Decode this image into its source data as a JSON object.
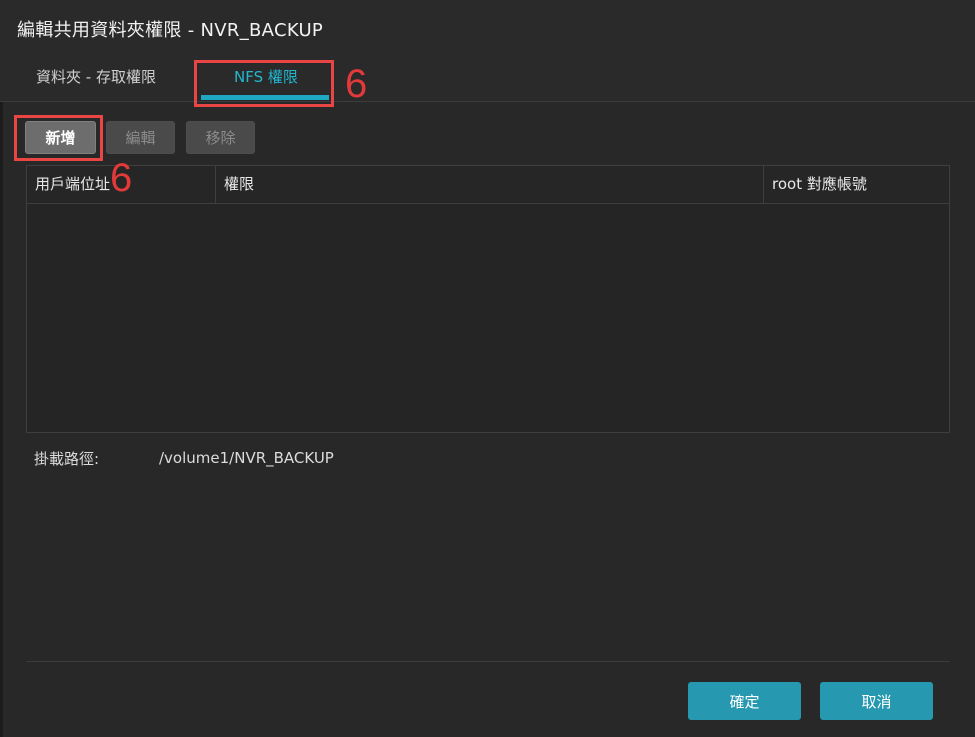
{
  "dialog": {
    "title": "編輯共用資料夾權限 - NVR_BACKUP"
  },
  "tabs": [
    {
      "label": "資料夾 - 存取權限",
      "active": false
    },
    {
      "label": "NFS 權限",
      "active": true
    }
  ],
  "toolbar": {
    "add_label": "新增",
    "edit_label": "編輯",
    "remove_label": "移除"
  },
  "table": {
    "columns": [
      "用戶端位址",
      "權限",
      "root 對應帳號"
    ],
    "rows": []
  },
  "mount": {
    "label": "掛載路徑:",
    "value": "/volume1/NVR_BACKUP"
  },
  "footer": {
    "ok_label": "確定",
    "cancel_label": "取消"
  },
  "annotations": {
    "tab_step": "6",
    "button_step": "6"
  },
  "colors": {
    "accent": "#22b6cf",
    "primary_button": "#2699b0",
    "annotation_red": "#e94545"
  }
}
